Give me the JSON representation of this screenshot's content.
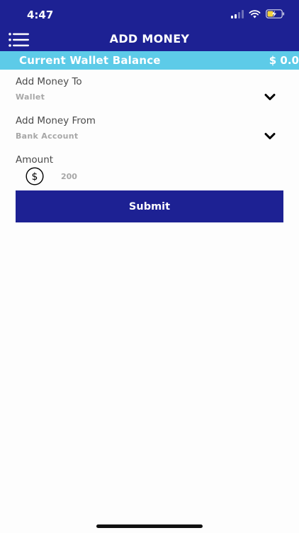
{
  "status_bar": {
    "time": "4:47"
  },
  "header": {
    "title": "ADD MONEY",
    "menu_icon": "hamburger-list-icon"
  },
  "balance": {
    "label": "Current Wallet Balance",
    "value": "$ 0.0"
  },
  "form": {
    "add_to": {
      "label": "Add Money To",
      "value": "Wallet"
    },
    "add_from": {
      "label": "Add Money From",
      "value": "Bank Account"
    },
    "amount": {
      "label": "Amount",
      "value": "200",
      "icon": "dollar-circle-icon"
    },
    "submit_label": "Submit"
  },
  "colors": {
    "primary": "#1d2193",
    "accent": "#5dcbe8",
    "label_text": "#4a4a4a",
    "value_text": "#a7a7a7"
  }
}
